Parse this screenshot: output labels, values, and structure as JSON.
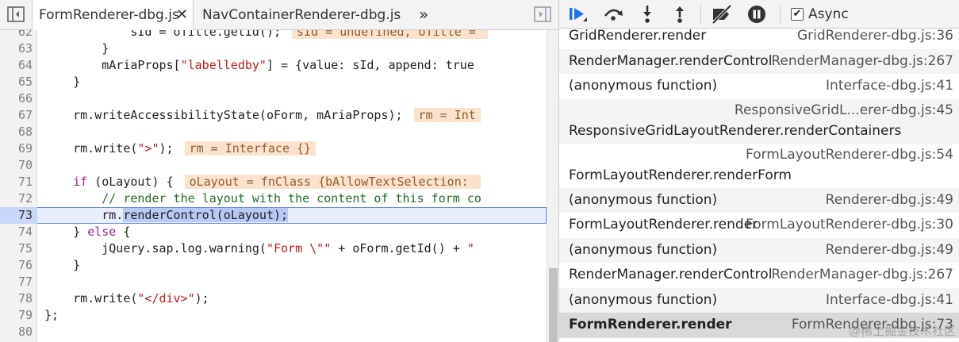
{
  "tabs": {
    "active": "FormRenderer-dbg.js",
    "close": "✕",
    "second": "NavContainerRenderer-dbg.js",
    "more": "»"
  },
  "code_lines": [
    {
      "num": "62",
      "segments": [
        [
          "",
          "            sId = oTitle.getId();"
        ],
        [
          "inline-val",
          "sId = undefined, oTitle = "
        ]
      ]
    },
    {
      "num": "63",
      "segments": [
        [
          "",
          "        }"
        ]
      ]
    },
    {
      "num": "64",
      "segments": [
        [
          "",
          "        mAriaProps["
        ],
        [
          "str",
          "\"labelledby\""
        ],
        [
          "",
          "] = {value: sId, append: true"
        ]
      ]
    },
    {
      "num": "65",
      "segments": [
        [
          "",
          "    }"
        ]
      ]
    },
    {
      "num": "66",
      "segments": [
        [
          "",
          ""
        ]
      ]
    },
    {
      "num": "67",
      "segments": [
        [
          "",
          "    rm.writeAccessibilityState(oForm, mAriaProps);"
        ],
        [
          "inline-val",
          "rm = Int"
        ]
      ]
    },
    {
      "num": "68",
      "segments": [
        [
          "",
          ""
        ]
      ]
    },
    {
      "num": "69",
      "segments": [
        [
          "",
          "    rm.write("
        ],
        [
          "str",
          "\">\""
        ],
        [
          "",
          ");"
        ],
        [
          "inline-val",
          "rm = Interface {}"
        ]
      ]
    },
    {
      "num": "70",
      "segments": [
        [
          "",
          ""
        ]
      ]
    },
    {
      "num": "71",
      "segments": [
        [
          "kw",
          "    if"
        ],
        [
          "",
          " (oLayout) {"
        ],
        [
          "inline-val",
          "oLayout = fnClass {bAllowTextSelection: "
        ]
      ]
    },
    {
      "num": "72",
      "segments": [
        [
          "cmt",
          "        // render the layout with the content of this form co"
        ]
      ]
    },
    {
      "num": "73",
      "current": true,
      "segments": [
        [
          "",
          "        rm."
        ],
        [
          "sel",
          "renderControl(oLayout);"
        ]
      ]
    },
    {
      "num": "74",
      "segments": [
        [
          "",
          "    } "
        ],
        [
          "kw",
          "else"
        ],
        [
          "",
          " {"
        ]
      ]
    },
    {
      "num": "75",
      "segments": [
        [
          "",
          "        jQuery.sap.log.warning("
        ],
        [
          "str",
          "\"Form \\\"\""
        ],
        [
          "",
          " + oForm.getId() + "
        ],
        [
          "str",
          "\""
        ]
      ]
    },
    {
      "num": "76",
      "segments": [
        [
          "",
          "    }"
        ]
      ]
    },
    {
      "num": "77",
      "segments": [
        [
          "",
          ""
        ]
      ]
    },
    {
      "num": "78",
      "segments": [
        [
          "",
          "    rm.write("
        ],
        [
          "str",
          "\"</div>\""
        ],
        [
          "",
          ");"
        ]
      ]
    },
    {
      "num": "79",
      "segments": [
        [
          "",
          "};"
        ]
      ]
    },
    {
      "num": "80",
      "segments": [
        [
          "",
          ""
        ]
      ]
    }
  ],
  "debugger": {
    "async_label": "Async",
    "async_checked": true,
    "buttons": [
      "resume-icon",
      "step-over-icon",
      "step-into-icon",
      "step-out-icon",
      "deactivate-breakpoints-icon",
      "pause-on-exceptions-icon"
    ]
  },
  "call_stack": [
    {
      "fn": "GridRenderer.render",
      "loc": "GridRenderer-dbg.js:36",
      "two_line": false
    },
    {
      "fn": "RenderManager.renderControl",
      "loc": "RenderManager-dbg.js:267",
      "two_line": false
    },
    {
      "fn": "(anonymous function)",
      "loc": "Interface-dbg.js:41",
      "two_line": false
    },
    {
      "fn": "ResponsiveGridLayoutRenderer.renderContainers",
      "loc": "ResponsiveGridL...erer-dbg.js:45",
      "two_line": true
    },
    {
      "fn": "FormLayoutRenderer.renderForm",
      "loc": "FormLayoutRenderer-dbg.js:54",
      "two_line": true
    },
    {
      "fn": "(anonymous function)",
      "loc": "Renderer-dbg.js:49",
      "two_line": false
    },
    {
      "fn": "FormLayoutRenderer.render",
      "loc": "FormLayoutRenderer-dbg.js:30",
      "two_line": false
    },
    {
      "fn": "(anonymous function)",
      "loc": "Renderer-dbg.js:49",
      "two_line": false
    },
    {
      "fn": "RenderManager.renderControl",
      "loc": "RenderManager-dbg.js:267",
      "two_line": false
    },
    {
      "fn": "(anonymous function)",
      "loc": "Interface-dbg.js:41",
      "two_line": false
    },
    {
      "fn": "FormRenderer.render",
      "loc": "FormRenderer-dbg.js:73",
      "two_line": false,
      "selected": true
    }
  ],
  "watermark": "@稀土掘金技术社区"
}
